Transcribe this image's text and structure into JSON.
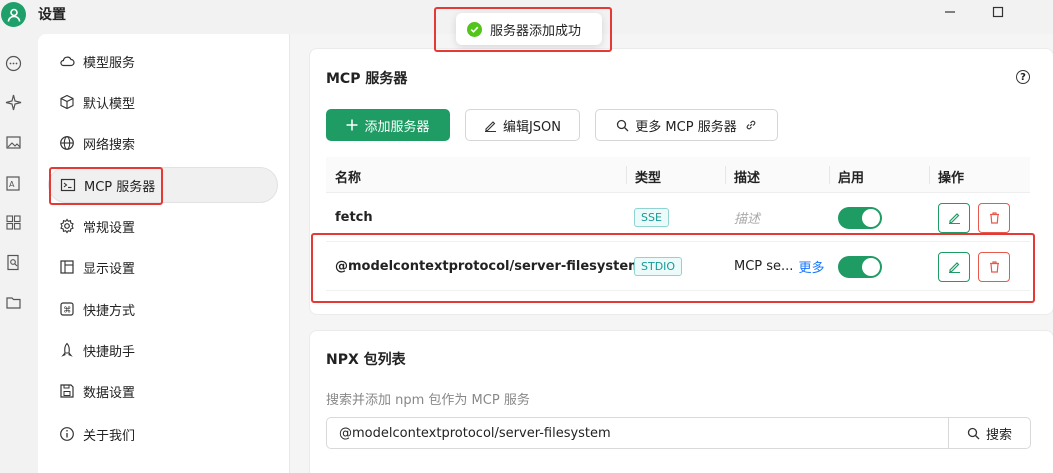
{
  "app": {
    "title": "设置"
  },
  "toast": {
    "message": "服务器添加成功",
    "status_color": "#52c41a"
  },
  "rail_icons": [
    "chat-icon",
    "sparkle-icon",
    "image-icon",
    "translate-icon",
    "apps-icon",
    "doc-search-icon",
    "folder-icon"
  ],
  "nav": {
    "items": [
      {
        "label": "模型服务",
        "icon": "cloud-icon"
      },
      {
        "label": "默认模型",
        "icon": "cube-icon"
      },
      {
        "label": "网络搜索",
        "icon": "globe-icon"
      },
      {
        "label": "MCP 服务器",
        "icon": "terminal-icon",
        "active": true
      },
      {
        "label": "常规设置",
        "icon": "gear-icon"
      },
      {
        "label": "显示设置",
        "icon": "layout-icon"
      },
      {
        "label": "快捷方式",
        "icon": "command-icon"
      },
      {
        "label": "快捷助手",
        "icon": "rocket-icon"
      },
      {
        "label": "数据设置",
        "icon": "save-icon"
      },
      {
        "label": "关于我们",
        "icon": "info-icon"
      }
    ]
  },
  "mcp": {
    "title": "MCP 服务器",
    "add_label": "添加服务器",
    "edit_json_label": "编辑JSON",
    "more_label": "更多 MCP 服务器",
    "columns": [
      "名称",
      "类型",
      "描述",
      "启用",
      "操作"
    ],
    "rows": [
      {
        "name": "fetch",
        "type": "SSE",
        "description": "描述",
        "description_placeholder": true,
        "enabled": true,
        "more": ""
      },
      {
        "name": "@modelcontextprotocol/server-filesystem",
        "type": "STDIO",
        "description": "MCP se...",
        "description_placeholder": false,
        "enabled": true,
        "more": "更多"
      }
    ]
  },
  "npx": {
    "title": "NPX 包列表",
    "description": "搜索并添加 npm 包作为 MCP 服务",
    "search_value": "@modelcontextprotocol/server-filesystem",
    "search_label": "搜索"
  },
  "colors": {
    "accent": "#1f9b64",
    "danger": "#e8594d",
    "highlight_box": "#e53935",
    "link": "#1677ff"
  }
}
